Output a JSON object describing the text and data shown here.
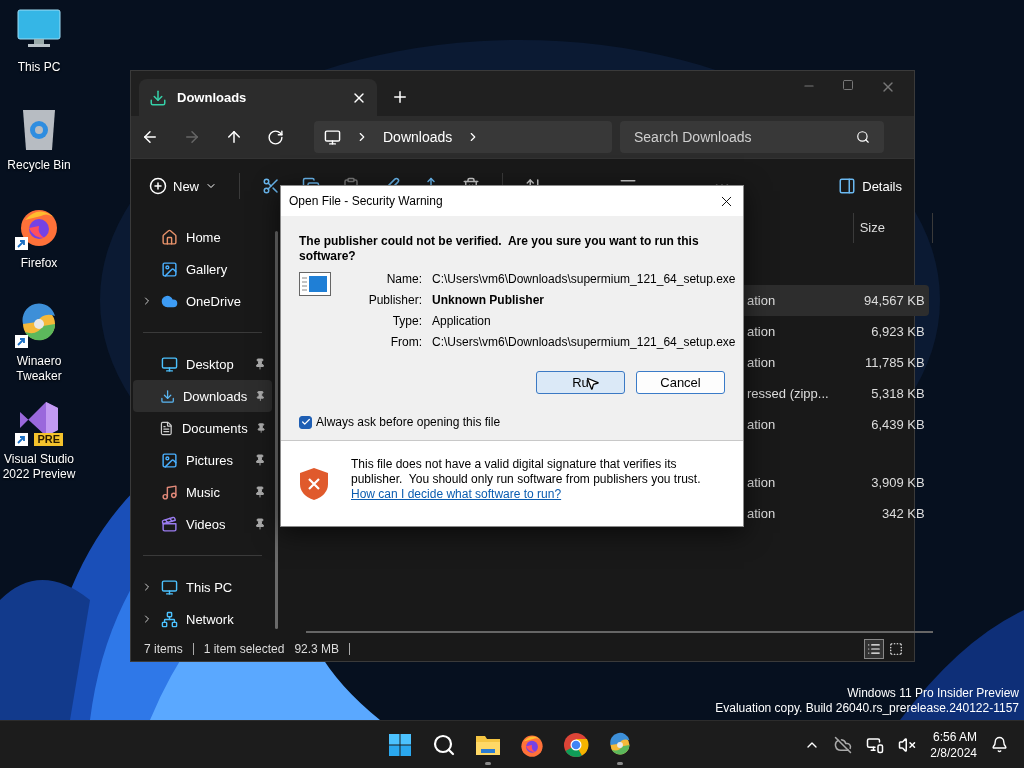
{
  "desktop_icons": [
    {
      "label": "This PC",
      "kind": "pc",
      "shortcut": false
    },
    {
      "label": "Recycle Bin",
      "kind": "bin",
      "shortcut": false
    },
    {
      "label": "Firefox",
      "kind": "firefox",
      "shortcut": true
    },
    {
      "label": "Winaero Tweaker",
      "kind": "winaero",
      "shortcut": true
    },
    {
      "label": "Visual Studio 2022 Preview",
      "kind": "vs",
      "shortcut": true,
      "badge": "PRE"
    }
  ],
  "explorer": {
    "tabs": [
      {
        "label": "Downloads",
        "selected": true
      }
    ],
    "address": {
      "crumbs": [
        "Downloads"
      ]
    },
    "search": {
      "placeholder": "Search Downloads"
    },
    "toolbar": {
      "new": "New",
      "details": "Details"
    },
    "nav": [
      {
        "label": "Home",
        "kind": "home",
        "expandable": false,
        "pinned": false,
        "selected": false
      },
      {
        "label": "Gallery",
        "kind": "gallery",
        "expandable": false,
        "pinned": false,
        "selected": false
      },
      {
        "label": "OneDrive",
        "kind": "cloud",
        "expandable": true,
        "pinned": false,
        "selected": false
      },
      {
        "label": "Desktop",
        "kind": "desktop",
        "expandable": false,
        "pinned": true,
        "selected": false,
        "section_start": true
      },
      {
        "label": "Downloads",
        "kind": "download",
        "expandable": false,
        "pinned": true,
        "selected": true
      },
      {
        "label": "Documents",
        "kind": "document",
        "expandable": false,
        "pinned": true,
        "selected": false
      },
      {
        "label": "Pictures",
        "kind": "picture",
        "expandable": false,
        "pinned": true,
        "selected": false
      },
      {
        "label": "Music",
        "kind": "music",
        "expandable": false,
        "pinned": true,
        "selected": false
      },
      {
        "label": "Videos",
        "kind": "video",
        "expandable": false,
        "pinned": true,
        "selected": false
      },
      {
        "label": "This PC",
        "kind": "pc",
        "expandable": true,
        "pinned": false,
        "selected": false,
        "section_start": true
      },
      {
        "label": "Network",
        "kind": "network",
        "expandable": true,
        "pinned": false,
        "selected": false
      }
    ],
    "columns": [
      "Size"
    ],
    "groups": [
      {
        "rows": [
          {
            "type": "ation",
            "size": "94,567 KB",
            "selected": true
          },
          {
            "type": "ation",
            "size": "6,923 KB",
            "selected": false
          },
          {
            "type": "ation",
            "size": "11,785 KB",
            "selected": false
          },
          {
            "type": "ressed (zipp...",
            "size": "5,318 KB",
            "selected": false
          },
          {
            "type": "ation",
            "size": "6,439 KB",
            "selected": false
          }
        ]
      },
      {
        "rows": [
          {
            "type": "ation",
            "size": "3,909 KB",
            "selected": false
          },
          {
            "type": "ation",
            "size": "342 KB",
            "selected": false
          }
        ]
      }
    ],
    "status": {
      "count": "7 items",
      "selection": "1 item selected",
      "selection_size": "92.3 MB"
    }
  },
  "dialog": {
    "title": "Open File - Security Warning",
    "question": "The publisher could not be verified.  Are you sure you want to run this software?",
    "fields": [
      {
        "label": "Name:",
        "value": "C:\\Users\\vm6\\Downloads\\supermium_121_64_setup.exe",
        "bold": false
      },
      {
        "label": "Publisher:",
        "value": "Unknown Publisher",
        "bold": true
      },
      {
        "label": "Type:",
        "value": "Application",
        "bold": false
      },
      {
        "label": "From:",
        "value": "C:\\Users\\vm6\\Downloads\\supermium_121_64_setup.exe",
        "bold": false
      }
    ],
    "buttons": [
      {
        "label": "Ru",
        "default": true
      },
      {
        "label": "Cancel",
        "default": false
      }
    ],
    "checkbox": {
      "label": "Always ask before opening this file",
      "checked": true
    },
    "warning": "This file does not have a valid digital signature that verifies its publisher.  You should only run software from publishers you trust.",
    "link": "How can I decide what software to run?"
  },
  "watermark": [
    "Windows 11 Pro Insider Preview",
    "Evaluation copy. Build 26040.rs_prerelease.240122-1157"
  ],
  "taskbar": {
    "apps": [
      {
        "kind": "start",
        "running": false
      },
      {
        "kind": "search",
        "running": false
      },
      {
        "kind": "explorer",
        "running": true
      },
      {
        "kind": "firefox",
        "running": false
      },
      {
        "kind": "chrome",
        "running": false
      },
      {
        "kind": "winaero",
        "running": true
      }
    ],
    "clock": {
      "time": "6:56 AM",
      "date": "2/8/2024"
    }
  }
}
